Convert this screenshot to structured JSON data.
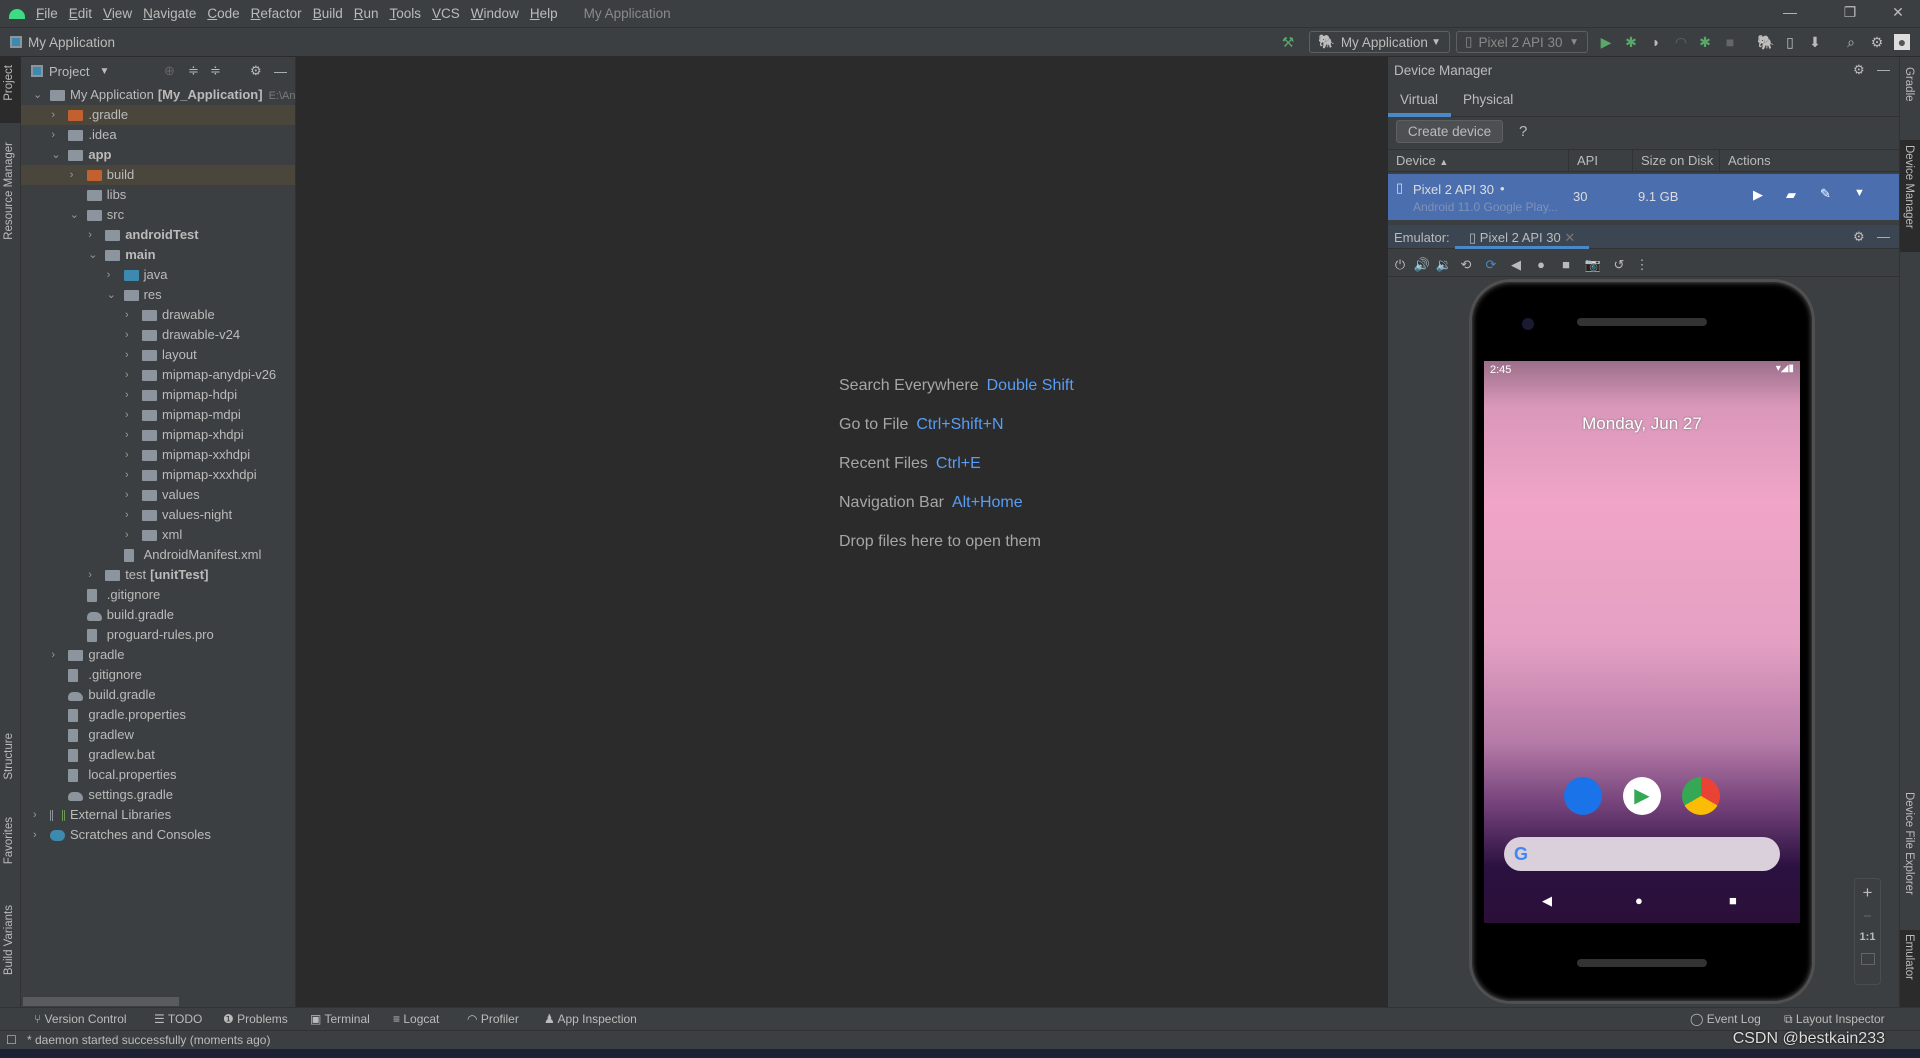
{
  "menu": [
    "File",
    "Edit",
    "View",
    "Navigate",
    "Code",
    "Refactor",
    "Build",
    "Run",
    "Tools",
    "VCS",
    "Window",
    "Help"
  ],
  "window_title": "My Application",
  "toolbar": {
    "breadcrumb": "My Application",
    "run_config": "My Application",
    "device": "Pixel 2 API 30"
  },
  "left_stripe": [
    "Project",
    "Resource Manager",
    "Structure",
    "Favorites",
    "Build Variants"
  ],
  "right_stripe": [
    "Gradle",
    "Device Manager",
    "Device File Explorer",
    "Emulator"
  ],
  "project": {
    "title": "Project",
    "tree": [
      {
        "d": 0,
        "a": "open",
        "i": "module",
        "t": "My Application",
        "b": "[My_Application]",
        "g": "E:\\An"
      },
      {
        "d": 1,
        "a": "closed",
        "i": "orange",
        "t": ".gradle",
        "hl": true
      },
      {
        "d": 1,
        "a": "closed",
        "i": "folder",
        "t": ".idea"
      },
      {
        "d": 1,
        "a": "open",
        "i": "folder",
        "t": "app",
        "bold": true
      },
      {
        "d": 2,
        "a": "closed",
        "i": "orange",
        "t": "build",
        "hl": true
      },
      {
        "d": 2,
        "a": "none",
        "i": "folder",
        "t": "libs"
      },
      {
        "d": 2,
        "a": "open",
        "i": "folder",
        "t": "src"
      },
      {
        "d": 3,
        "a": "closed",
        "i": "folder",
        "t": "androidTest",
        "bold": true
      },
      {
        "d": 3,
        "a": "open",
        "i": "folder",
        "t": "main",
        "bold": true
      },
      {
        "d": 4,
        "a": "closed",
        "i": "blue",
        "t": "java"
      },
      {
        "d": 4,
        "a": "open",
        "i": "folder",
        "t": "res"
      },
      {
        "d": 5,
        "a": "closed",
        "i": "folder",
        "t": "drawable"
      },
      {
        "d": 5,
        "a": "closed",
        "i": "folder",
        "t": "drawable-v24"
      },
      {
        "d": 5,
        "a": "closed",
        "i": "folder",
        "t": "layout"
      },
      {
        "d": 5,
        "a": "closed",
        "i": "folder",
        "t": "mipmap-anydpi-v26"
      },
      {
        "d": 5,
        "a": "closed",
        "i": "folder",
        "t": "mipmap-hdpi"
      },
      {
        "d": 5,
        "a": "closed",
        "i": "folder",
        "t": "mipmap-mdpi"
      },
      {
        "d": 5,
        "a": "closed",
        "i": "folder",
        "t": "mipmap-xhdpi"
      },
      {
        "d": 5,
        "a": "closed",
        "i": "folder",
        "t": "mipmap-xxhdpi"
      },
      {
        "d": 5,
        "a": "closed",
        "i": "folder",
        "t": "mipmap-xxxhdpi"
      },
      {
        "d": 5,
        "a": "closed",
        "i": "folder",
        "t": "values"
      },
      {
        "d": 5,
        "a": "closed",
        "i": "folder",
        "t": "values-night"
      },
      {
        "d": 5,
        "a": "closed",
        "i": "folder",
        "t": "xml"
      },
      {
        "d": 4,
        "a": "none",
        "i": "manifest",
        "t": "AndroidManifest.xml"
      },
      {
        "d": 3,
        "a": "closed",
        "i": "module",
        "t": "test",
        "b": "[unitTest]"
      },
      {
        "d": 2,
        "a": "none",
        "i": "file",
        "t": ".gitignore"
      },
      {
        "d": 2,
        "a": "none",
        "i": "gradle",
        "t": "build.gradle"
      },
      {
        "d": 2,
        "a": "none",
        "i": "file",
        "t": "proguard-rules.pro"
      },
      {
        "d": 1,
        "a": "closed",
        "i": "folder",
        "t": "gradle"
      },
      {
        "d": 1,
        "a": "none",
        "i": "file",
        "t": ".gitignore"
      },
      {
        "d": 1,
        "a": "none",
        "i": "gradle",
        "t": "build.gradle"
      },
      {
        "d": 1,
        "a": "none",
        "i": "props",
        "t": "gradle.properties"
      },
      {
        "d": 1,
        "a": "none",
        "i": "cpp",
        "t": "gradlew"
      },
      {
        "d": 1,
        "a": "none",
        "i": "file",
        "t": "gradlew.bat"
      },
      {
        "d": 1,
        "a": "none",
        "i": "props",
        "t": "local.properties"
      },
      {
        "d": 1,
        "a": "none",
        "i": "gradle",
        "t": "settings.gradle"
      },
      {
        "d": 0,
        "a": "closed",
        "i": "libs",
        "t": "External Libraries"
      },
      {
        "d": 0,
        "a": "closed",
        "i": "scratch",
        "t": "Scratches and Consoles"
      }
    ]
  },
  "editor": {
    "hints": [
      {
        "label": "Search Everywhere",
        "key": "Double Shift"
      },
      {
        "label": "Go to File",
        "key": "Ctrl+Shift+N"
      },
      {
        "label": "Recent Files",
        "key": "Ctrl+E"
      },
      {
        "label": "Navigation Bar",
        "key": "Alt+Home"
      },
      {
        "label": "Drop files here to open them",
        "key": ""
      }
    ]
  },
  "device_manager": {
    "title": "Device Manager",
    "tabs": [
      "Virtual",
      "Physical"
    ],
    "create": "Create device",
    "help": "?",
    "columns": [
      "Device",
      "API",
      "Size on Disk",
      "Actions"
    ],
    "row": {
      "name": "Pixel 2 API 30",
      "sub": "Android 11.0 Google Play...",
      "api": "30",
      "size": "9.1 GB"
    },
    "emulator_label": "Emulator:",
    "emulator_tab": "Pixel 2 API 30",
    "phone": {
      "time": "2:45",
      "date": "Monday, Jun 27"
    },
    "zoom": {
      "plus": "+",
      "minus": "−",
      "one": "1:1"
    }
  },
  "bottom": {
    "left": [
      "Version Control",
      "TODO",
      "Problems",
      "Terminal",
      "Logcat",
      "Profiler",
      "App Inspection"
    ],
    "right": [
      "Event Log",
      "Layout Inspector"
    ]
  },
  "status": "* daemon started successfully (moments ago)",
  "watermark": "CSDN @bestkain233",
  "colors": {
    "accent": "#4a88c7",
    "selection": "#4b6eaf",
    "shortcut": "#589df6",
    "android_green": "#3ddc84"
  }
}
